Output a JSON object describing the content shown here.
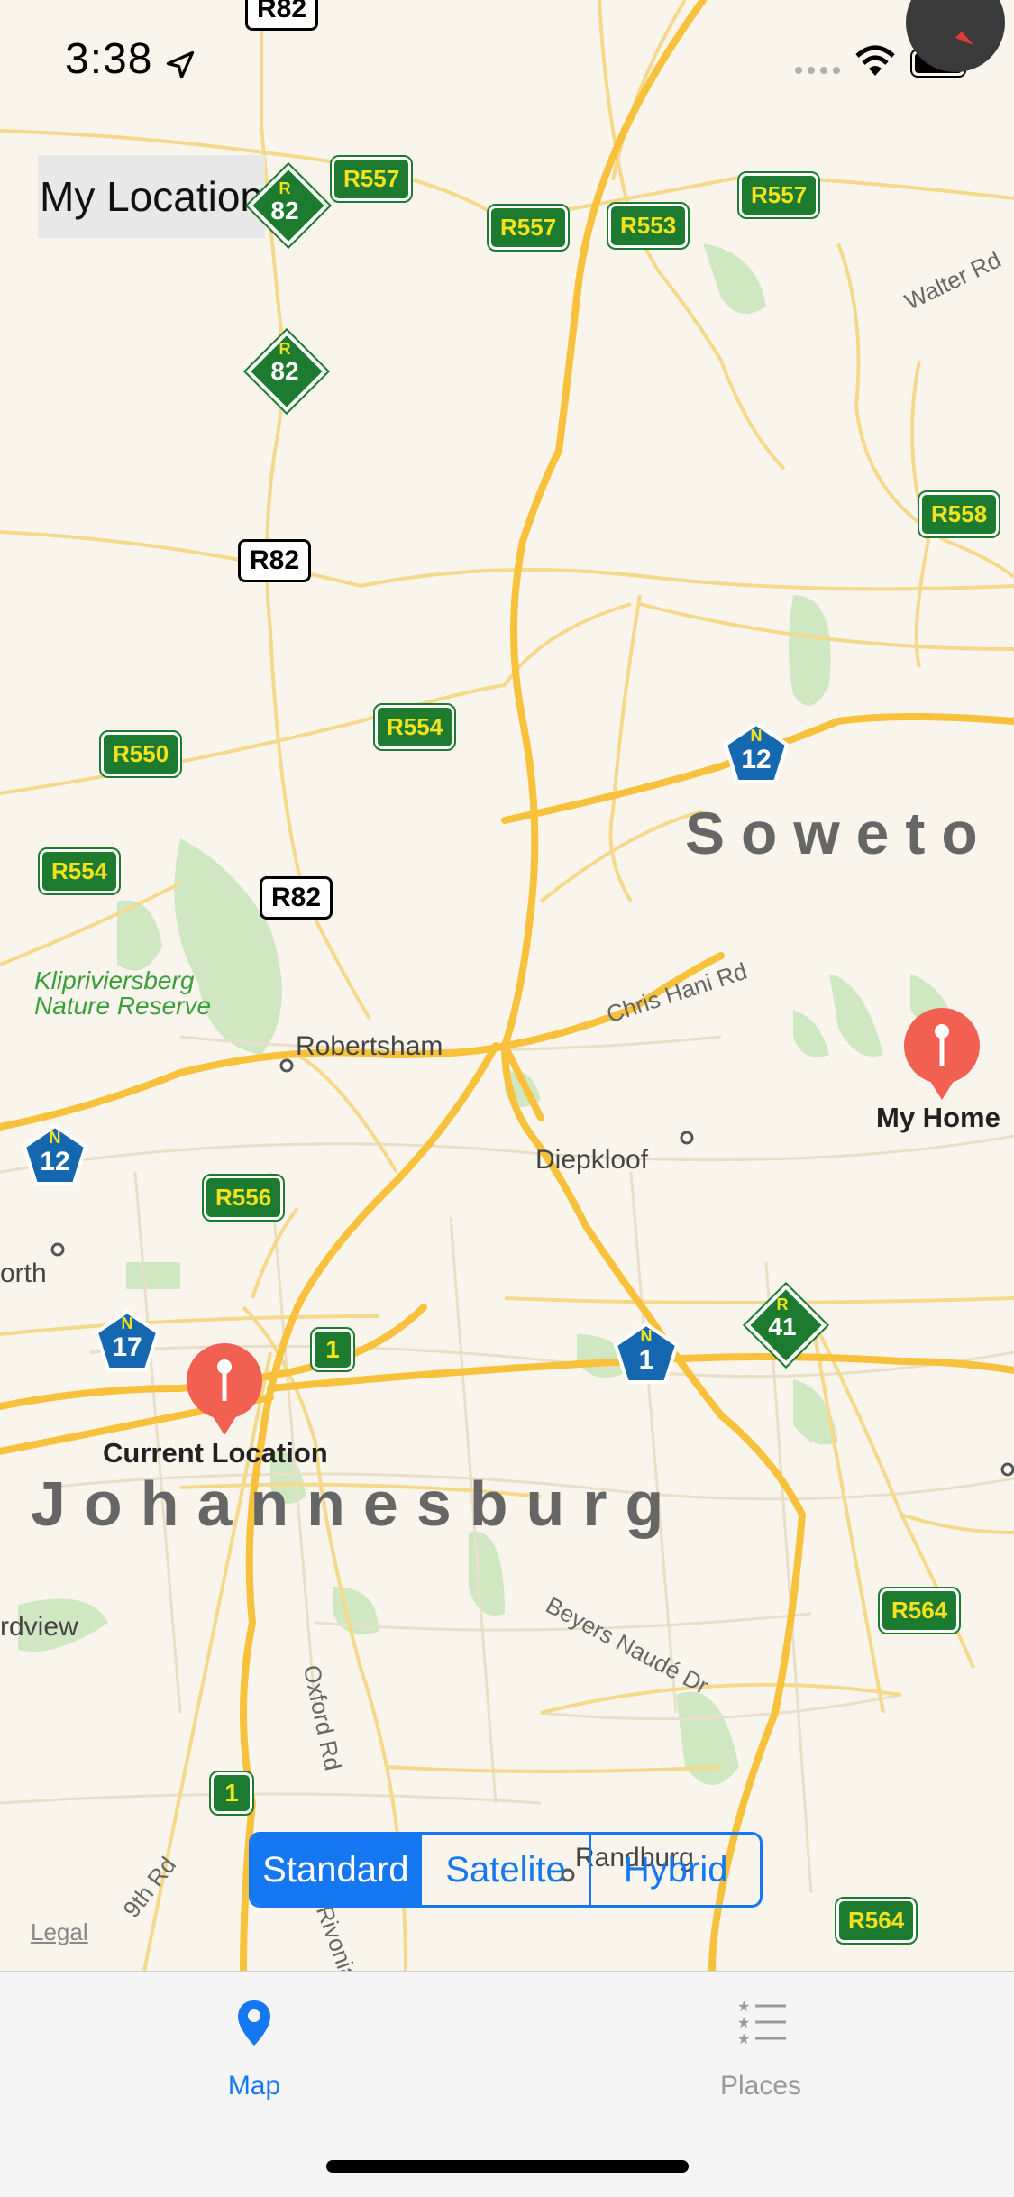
{
  "status_bar": {
    "time": "3:38"
  },
  "map": {
    "my_location_button": "My Location",
    "road_signs": {
      "r82_top": "R82",
      "r557_a": "R557",
      "r557_b": "R557",
      "r553": "R553",
      "r557_c": "R557",
      "r558": "R558",
      "r82_mid": "R82",
      "r554_a": "R554",
      "r550": "R550",
      "r554_b": "R554",
      "r82_low": "R82",
      "r556": "R556",
      "r564_a": "R564",
      "r564_b": "R564",
      "n12_east": "12",
      "n12_west": "12",
      "n17": "17",
      "n1": "1",
      "r41": "41",
      "r82_diamond": "82",
      "r82_diamond_top": "82",
      "m1_a": "1",
      "m1_b": "1",
      "n_prefix": "N",
      "r_prefix": "R"
    },
    "places": {
      "soweto": "Soweto",
      "johannesburg": "Johannesburg",
      "robertsham": "Robertsham",
      "diepkloof": "Diepkloof",
      "randburg": "Randburg",
      "north": "orth",
      "rdview": "rdview",
      "kliprivier_line1": "Klipriviersberg",
      "kliprivier_line2": "Nature Reserve"
    },
    "streets": {
      "walter_rd": "Walter Rd",
      "chris_hani": "Chris Hani Rd",
      "beyers_naude": "Beyers Naudé Dr",
      "oxford_rd": "Oxford Rd",
      "ninth_rd": "9th Rd",
      "rivonia": "Rivonia"
    },
    "pins": {
      "my_home": "My Home",
      "current_location": "Current Location"
    },
    "legal": "Legal",
    "segmented": {
      "standard": "Standard",
      "satellite": "Satelite",
      "hybrid": "Hybrid",
      "selected": "Standard"
    }
  },
  "tabbar": {
    "map": "Map",
    "places": "Places"
  },
  "colors": {
    "accent": "#1677f2",
    "pin": "#f26052",
    "road_major": "#f7c13b",
    "sign_green": "#1c7b2e",
    "sign_yellow": "#f4e21f",
    "sign_blue": "#1568b0",
    "park": "#cfe8c2"
  }
}
